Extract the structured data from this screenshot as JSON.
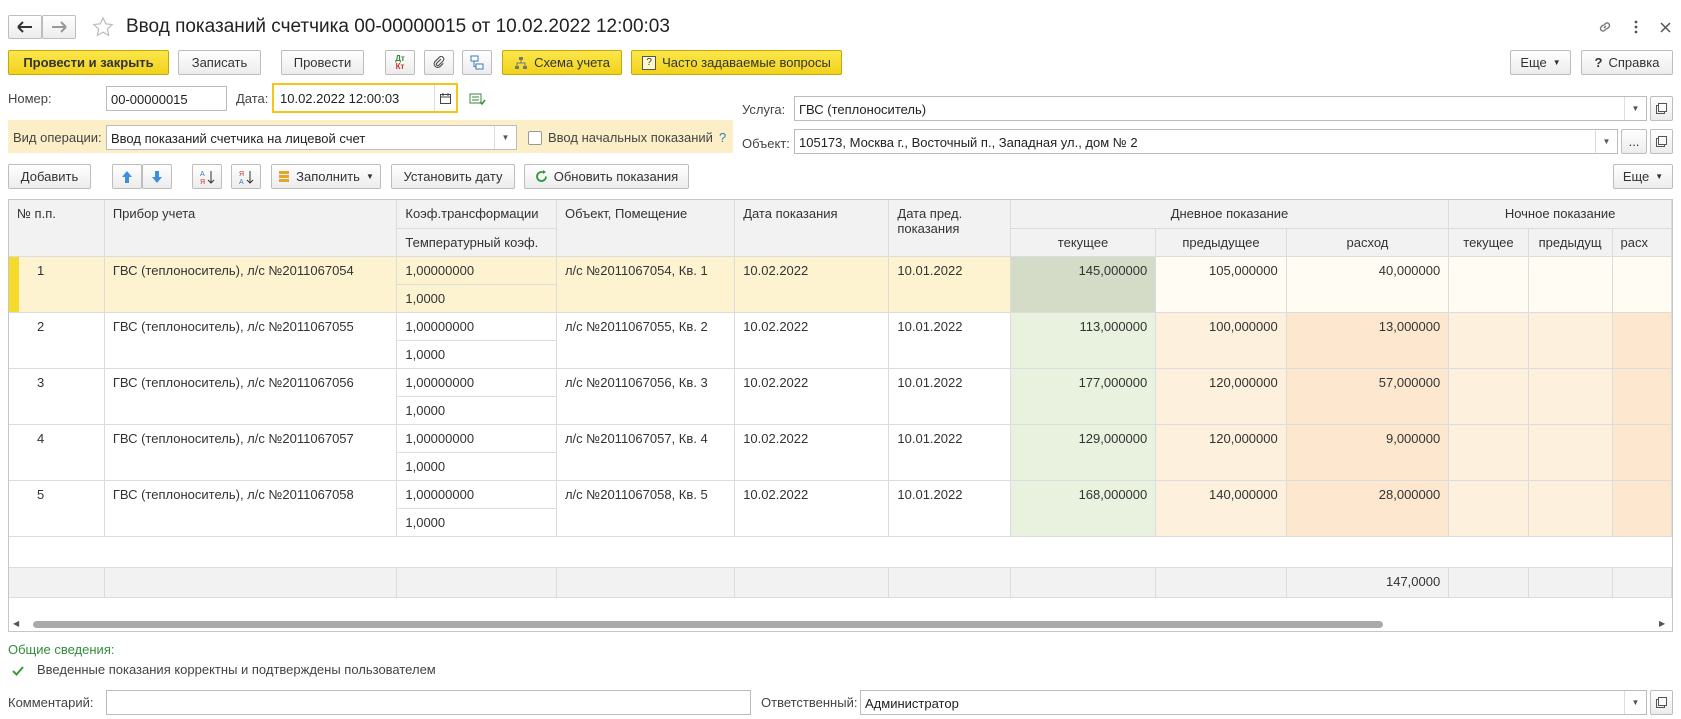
{
  "window": {
    "title": "Ввод показаний счетчика 00-00000015 от 10.02.2022 12:00:03"
  },
  "toolbar": {
    "post_close": "Провести и закрыть",
    "save": "Записать",
    "post": "Провести",
    "scheme": "Схема учета",
    "faq": "Часто задаваемые вопросы",
    "more": "Еще",
    "help": "Справка",
    "dtkt_top": "Дт",
    "dtkt_bottom": "Кт",
    "faq_mark": "?"
  },
  "header": {
    "number_label": "Номер:",
    "number_value": "00-00000015",
    "date_label": "Дата:",
    "date_value": "10.02.2022 12:00:03",
    "operation_label": "Вид операции:",
    "operation_value": "Ввод показаний счетчика на лицевой счет",
    "initial_label": "Ввод начальных показаний",
    "initial_help": "?",
    "service_label": "Услуга:",
    "service_value": "ГВС (теплоноситель)",
    "object_label": "Объект:",
    "object_value": "105173, Москва г., Восточный п., Западная ул., дом № 2",
    "object_more": "..."
  },
  "table_toolbar": {
    "add": "Добавить",
    "fill": "Заполнить",
    "set_date": "Установить дату",
    "refresh": "Обновить показания",
    "more": "Еще"
  },
  "table": {
    "columns": {
      "num": "№ п.п.",
      "device": "Прибор учета",
      "coef": "Коэф.трансформации",
      "temp": "Температурный коэф.",
      "object": "Объект, Помещение",
      "date": "Дата показания",
      "prev_date": "Дата пред. показания",
      "day_group": "Дневное показание",
      "night_group": "Ночное показание",
      "current": "текущее",
      "previous": "предыдущее",
      "usage": "расход",
      "n_current": "текущее",
      "n_previous": "предыдущ",
      "n_usage": "расх"
    },
    "rows": [
      {
        "num": "1",
        "device": "ГВС (теплоноситель), л/с №2011067054",
        "coef": "1,00000000",
        "temp": "1,0000",
        "object": "л/с №2011067054, Кв. 1",
        "date": "10.02.2022",
        "prev_date": "10.01.2022",
        "current": "145,000000",
        "previous": "105,000000",
        "usage": "40,000000"
      },
      {
        "num": "2",
        "device": "ГВС (теплоноситель), л/с №2011067055",
        "coef": "1,00000000",
        "temp": "1,0000",
        "object": "л/с №2011067055, Кв. 2",
        "date": "10.02.2022",
        "prev_date": "10.01.2022",
        "current": "113,000000",
        "previous": "100,000000",
        "usage": "13,000000"
      },
      {
        "num": "3",
        "device": "ГВС (теплоноситель), л/с №2011067056",
        "coef": "1,00000000",
        "temp": "1,0000",
        "object": "л/с №2011067056, Кв. 3",
        "date": "10.02.2022",
        "prev_date": "10.01.2022",
        "current": "177,000000",
        "previous": "120,000000",
        "usage": "57,000000"
      },
      {
        "num": "4",
        "device": "ГВС (теплоноситель), л/с №2011067057",
        "coef": "1,00000000",
        "temp": "1,0000",
        "object": "л/с №2011067057, Кв. 4",
        "date": "10.02.2022",
        "prev_date": "10.01.2022",
        "current": "129,000000",
        "previous": "120,000000",
        "usage": "9,000000"
      },
      {
        "num": "5",
        "device": "ГВС (теплоноситель), л/с №2011067058",
        "coef": "1,00000000",
        "temp": "1,0000",
        "object": "л/с №2011067058, Кв. 5",
        "date": "10.02.2022",
        "prev_date": "10.01.2022",
        "current": "168,000000",
        "previous": "140,000000",
        "usage": "28,000000"
      }
    ],
    "footer_total": "147,0000"
  },
  "footer": {
    "general_label": "Общие сведения:",
    "confirmed_text": "Введенные показания корректны и подтверждены пользователем",
    "comment_label": "Комментарий:",
    "comment_value": "",
    "responsible_label": "Ответственный:",
    "responsible_value": "Администратор"
  },
  "colors": {
    "accent_yellow": "#f5d92b",
    "row_selected": "#fdf3d0",
    "current_col": "#e8f2de",
    "previous_col": "#fdf0dc",
    "usage_col": "#fde8cf",
    "section_green": "#2f8f3c"
  }
}
